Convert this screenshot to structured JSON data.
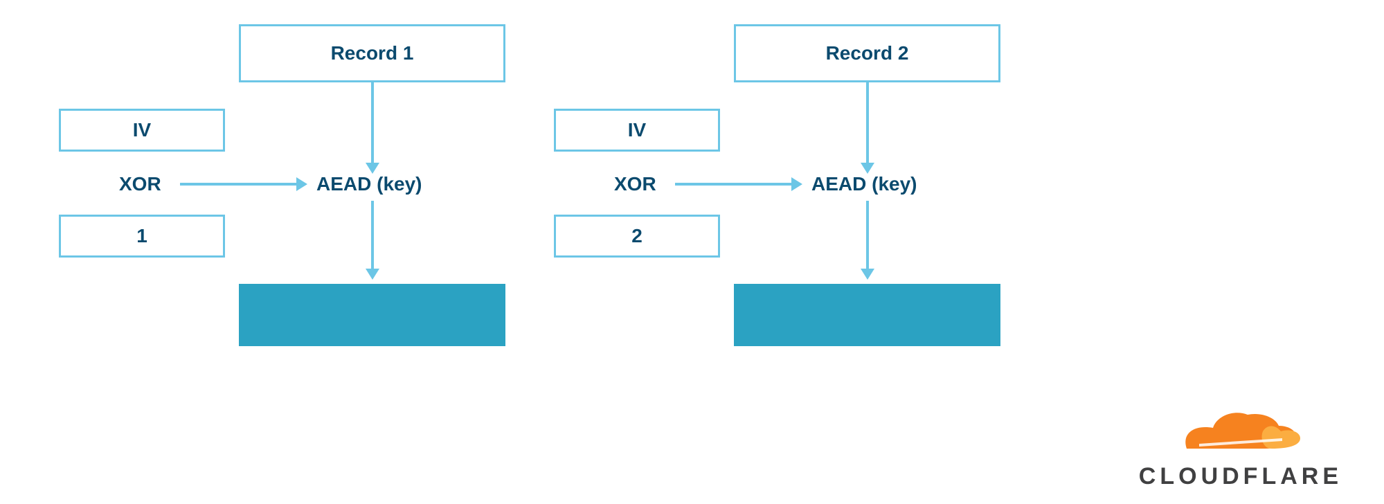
{
  "diagrams": [
    {
      "record_label": "Record 1",
      "iv_label": "IV",
      "xor_label": "XOR",
      "counter_label": "1",
      "aead_label": "AEAD (key)"
    },
    {
      "record_label": "Record 2",
      "iv_label": "IV",
      "xor_label": "XOR",
      "counter_label": "2",
      "aead_label": "AEAD (key)"
    }
  ],
  "logo": {
    "text": "CLOUDFLARE"
  },
  "colors": {
    "border": "#6cc6e6",
    "box_fill": "#2ba2c2",
    "text": "#0b4a6e",
    "logo_orange": "#f6821f",
    "logo_orange_light": "#fbad41",
    "logo_text": "#404041"
  }
}
